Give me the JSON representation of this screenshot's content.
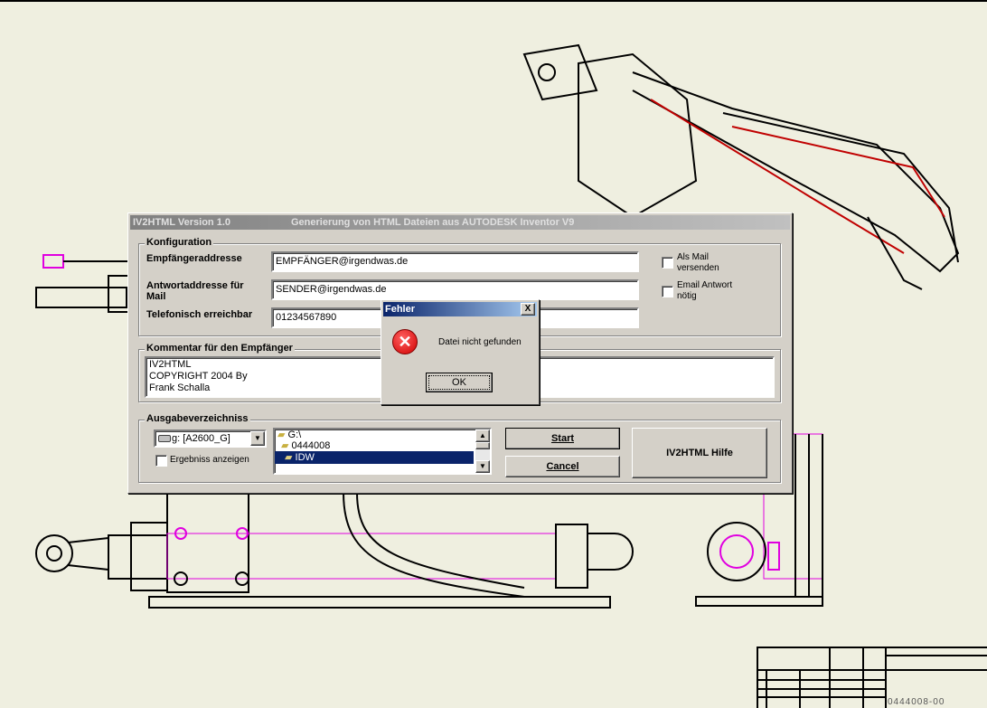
{
  "main_dialog": {
    "title": "IV2HTML Version 1.0",
    "subtitle": "Generierung von HTML Dateien aus AUTODESK Inventor V9",
    "config_group": "Konfiguration",
    "recipient_label": "Empfängeraddresse",
    "recipient_value": "EMPFÄNGER@irgendwas.de",
    "reply_label": "Antwortaddresse für Mail",
    "reply_value": "SENDER@irgendwas.de",
    "phone_label": "Telefonisch erreichbar",
    "phone_value": "01234567890",
    "send_mail_label": "Als Mail versenden",
    "reply_needed_label": "Email Antwort nötig",
    "comment_group": "Kommentar für den Empfänger",
    "comment_lines": [
      "IV2HTML",
      "COPYRIGHT 2004 By",
      "Frank Schalla"
    ],
    "output_group": "Ausgabeverzeichniss",
    "drive_value": "g: [A2600_G]",
    "show_result_label": "Ergebniss anzeigen",
    "folders": [
      "G:\\",
      "0444008",
      "IDW"
    ],
    "start_label": "Start",
    "cancel_label": "Cancel",
    "help_label": "IV2HTML  Hilfe"
  },
  "error_dialog": {
    "title": "Fehler",
    "message": "Datei nicht gefunden",
    "ok_label": "OK",
    "close_label": "X"
  },
  "drawing": {
    "number": "0444008-00"
  }
}
